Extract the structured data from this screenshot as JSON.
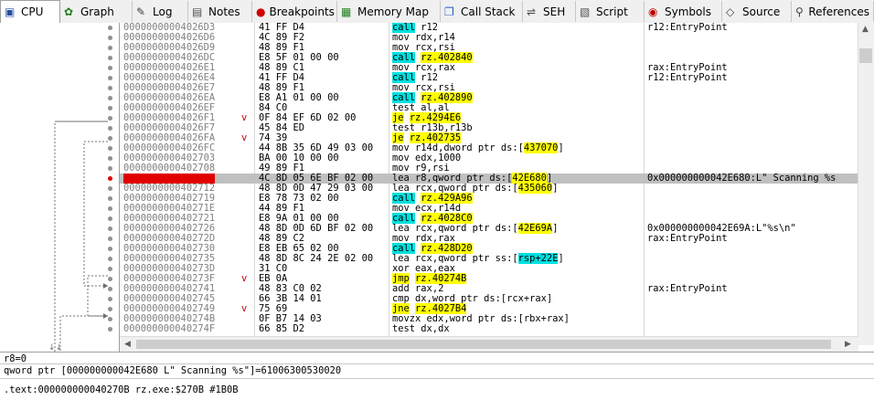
{
  "tabs": [
    {
      "label": "CPU",
      "icon": "cpu-icon",
      "active": true
    },
    {
      "label": "Graph",
      "icon": "graph-icon"
    },
    {
      "label": "Log",
      "icon": "log-icon"
    },
    {
      "label": "Notes",
      "icon": "notes-icon"
    },
    {
      "label": "Breakpoints",
      "icon": "breakpoint-icon"
    },
    {
      "label": "Memory Map",
      "icon": "memory-map-icon"
    },
    {
      "label": "Call Stack",
      "icon": "call-stack-icon"
    },
    {
      "label": "SEH",
      "icon": "seh-icon"
    },
    {
      "label": "Script",
      "icon": "script-icon"
    },
    {
      "label": "Symbols",
      "icon": "symbols-icon"
    },
    {
      "label": "Source",
      "icon": "source-icon"
    },
    {
      "label": "References",
      "icon": "references-icon"
    }
  ],
  "rows": [
    {
      "addr": "00000000004026D3",
      "bytes": "41 FF D4",
      "ins": "call",
      "ops": [
        {
          "t": "r12"
        }
      ],
      "cmt": "r12:EntryPoint"
    },
    {
      "addr": "00000000004026D6",
      "bytes": "4C 89 F2",
      "ins": "mov",
      "ops": [
        {
          "t": "rdx,r14"
        }
      ],
      "cmt": ""
    },
    {
      "addr": "00000000004026D9",
      "bytes": "48 89 F1",
      "ins": "mov",
      "ops": [
        {
          "t": "rcx,rsi"
        }
      ],
      "cmt": ""
    },
    {
      "addr": "00000000004026DC",
      "bytes": "E8 5F 01 00 00",
      "ins": "call",
      "ops": [
        {
          "t": "rz.402840",
          "hl": "jmp"
        }
      ],
      "cmt": ""
    },
    {
      "addr": "00000000004026E1",
      "bytes": "48 89 C1",
      "ins": "mov",
      "ops": [
        {
          "t": "rcx,rax"
        }
      ],
      "cmt": "rax:EntryPoint"
    },
    {
      "addr": "00000000004026E4",
      "bytes": "41 FF D4",
      "ins": "call",
      "ops": [
        {
          "t": "r12"
        }
      ],
      "cmt": "r12:EntryPoint"
    },
    {
      "addr": "00000000004026E7",
      "bytes": "48 89 F1",
      "ins": "mov",
      "ops": [
        {
          "t": "rcx,rsi"
        }
      ],
      "cmt": ""
    },
    {
      "addr": "00000000004026EA",
      "bytes": "E8 A1 01 00 00",
      "ins": "call",
      "ops": [
        {
          "t": "rz.402890",
          "hl": "jmp"
        }
      ],
      "cmt": ""
    },
    {
      "addr": "00000000004026EF",
      "bytes": "84 C0",
      "ins": "test",
      "ops": [
        {
          "t": "al,al"
        }
      ],
      "cmt": ""
    },
    {
      "addr": "00000000004026F1",
      "bytes": "0F 84 EF 6D 02 00",
      "ins": "je",
      "ops": [
        {
          "t": "rz.4294E6"
        }
      ],
      "cmt": "",
      "arrow": "v"
    },
    {
      "addr": "00000000004026F7",
      "bytes": "45 84 ED",
      "ins": "test",
      "ops": [
        {
          "t": "r13b,r13b"
        }
      ],
      "cmt": ""
    },
    {
      "addr": "00000000004026FA",
      "bytes": "74 39",
      "ins": "je",
      "ops": [
        {
          "t": "rz.402735"
        }
      ],
      "cmt": "",
      "arrow": "v"
    },
    {
      "addr": "00000000004026FC",
      "bytes": "44 8B 35 6D 49 03 00",
      "ins": "mov",
      "ops": [
        {
          "t": "r14d,dword ptr ds:["
        },
        {
          "t": "437070",
          "hl": "mem"
        },
        {
          "t": "]"
        }
      ],
      "cmt": ""
    },
    {
      "addr": "0000000000402703",
      "bytes": "BA 00 10 00 00",
      "ins": "mov",
      "ops": [
        {
          "t": "edx,1000"
        }
      ],
      "cmt": ""
    },
    {
      "addr": "0000000000402708",
      "bytes": "49 89 F1",
      "ins": "mov",
      "ops": [
        {
          "t": "r9,rsi"
        }
      ],
      "cmt": ""
    },
    {
      "addr": "000000000040270B",
      "bytes": "4C 8D 05 6E BF 02 00",
      "ins": "lea",
      "ops": [
        {
          "t": "r8,qword ptr ds:["
        },
        {
          "t": "42E680",
          "hl": "mem"
        },
        {
          "t": "]"
        }
      ],
      "cmt": "0x000000000042E680:L\" Scanning %s",
      "sel": true
    },
    {
      "addr": "0000000000402712",
      "bytes": "48 8D 0D 47 29 03 00",
      "ins": "lea",
      "ops": [
        {
          "t": "rcx,qword ptr ds:["
        },
        {
          "t": "435060",
          "hl": "mem"
        },
        {
          "t": "]"
        }
      ],
      "cmt": ""
    },
    {
      "addr": "0000000000402719",
      "bytes": "E8 78 73 02 00",
      "ins": "call",
      "ops": [
        {
          "t": "rz.429A96",
          "hl": "jmp"
        }
      ],
      "cmt": ""
    },
    {
      "addr": "000000000040271E",
      "bytes": "44 89 F1",
      "ins": "mov",
      "ops": [
        {
          "t": "ecx,r14d"
        }
      ],
      "cmt": ""
    },
    {
      "addr": "0000000000402721",
      "bytes": "E8 9A 01 00 00",
      "ins": "call",
      "ops": [
        {
          "t": "rz.4028C0",
          "hl": "jmp"
        }
      ],
      "cmt": ""
    },
    {
      "addr": "0000000000402726",
      "bytes": "48 8D 0D 6D BF 02 00",
      "ins": "lea",
      "ops": [
        {
          "t": "rcx,qword ptr ds:["
        },
        {
          "t": "42E69A",
          "hl": "mem"
        },
        {
          "t": "]"
        }
      ],
      "cmt": "0x000000000042E69A:L\"%s\\n\""
    },
    {
      "addr": "000000000040272D",
      "bytes": "48 89 C2",
      "ins": "mov",
      "ops": [
        {
          "t": "rdx,rax"
        }
      ],
      "cmt": "rax:EntryPoint"
    },
    {
      "addr": "0000000000402730",
      "bytes": "E8 EB 65 02 00",
      "ins": "call",
      "ops": [
        {
          "t": "rz.428D20",
          "hl": "jmp"
        }
      ],
      "cmt": ""
    },
    {
      "addr": "0000000000402735",
      "bytes": "48 8D 8C 24 2E 02 00",
      "ins": "lea",
      "ops": [
        {
          "t": "rcx,qword ptr ss:["
        },
        {
          "t": "rsp+22E",
          "hl": "call"
        },
        {
          "t": "]"
        }
      ],
      "cmt": ""
    },
    {
      "addr": "000000000040273D",
      "bytes": "31 C0",
      "ins": "xor",
      "ops": [
        {
          "t": "eax,eax"
        }
      ],
      "cmt": ""
    },
    {
      "addr": "000000000040273F",
      "bytes": "EB 0A",
      "ins": "jmp",
      "ops": [
        {
          "t": "rz.40274B"
        }
      ],
      "cmt": "",
      "arrow": "v"
    },
    {
      "addr": "0000000000402741",
      "bytes": "48 83 C0 02",
      "ins": "add",
      "ops": [
        {
          "t": "rax,2"
        }
      ],
      "cmt": "rax:EntryPoint"
    },
    {
      "addr": "0000000000402745",
      "bytes": "66 3B 14 01",
      "ins": "cmp",
      "ops": [
        {
          "t": "dx,word ptr ds:[rcx+rax]"
        }
      ],
      "cmt": ""
    },
    {
      "addr": "0000000000402749",
      "bytes": "75 69",
      "ins": "jne",
      "ops": [
        {
          "t": "rz.4027B4"
        }
      ],
      "cmt": "",
      "arrow": "v"
    },
    {
      "addr": "000000000040274B",
      "bytes": "0F B7 14 03",
      "ins": "movzx",
      "ops": [
        {
          "t": "edx,word ptr ds:[rbx+rax]"
        }
      ],
      "cmt": ""
    },
    {
      "addr": "000000000040274F",
      "bytes": "66 85 D2",
      "ins": "test",
      "ops": [
        {
          "t": "dx,dx"
        }
      ],
      "cmt": ""
    }
  ],
  "status": {
    "line1": "r8=0",
    "line2": "qword ptr [000000000042E680 L\" Scanning %s\"]=61006300530020",
    "line3": ".text:000000000040270B rz.exe:$270B #1B0B"
  }
}
